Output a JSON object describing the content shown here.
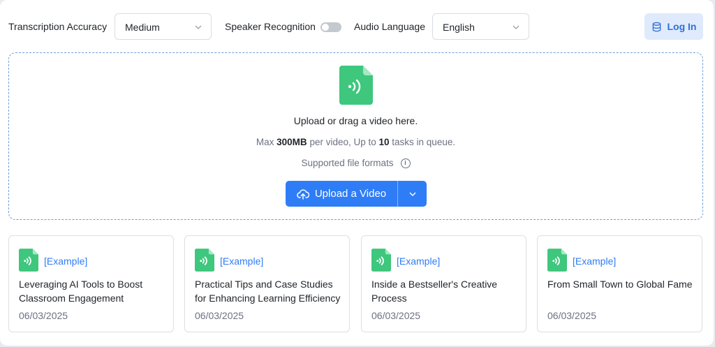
{
  "toolbar": {
    "accuracy_label": "Transcription Accuracy",
    "accuracy_value": "Medium",
    "speaker_label": "Speaker Recognition",
    "speaker_enabled": false,
    "language_label": "Audio Language",
    "language_value": "English",
    "login_label": "Log In"
  },
  "dropzone": {
    "title": "Upload or drag a video here.",
    "limit_prefix": "Max ",
    "limit_size": "300MB",
    "limit_mid": " per video, Up to ",
    "limit_count": "10",
    "limit_suffix": " tasks in queue.",
    "formats_label": "Supported file formats",
    "upload_button": "Upload a Video"
  },
  "cards": [
    {
      "tag": "[Example]",
      "title": "Leveraging AI Tools to Boost Classroom Engagement",
      "date": "06/03/2025"
    },
    {
      "tag": "[Example]",
      "title": "Practical Tips and Case Studies for Enhancing Learning Efficiency",
      "date": "06/03/2025"
    },
    {
      "tag": "[Example]",
      "title": "Inside a Bestseller's Creative Process",
      "date": "06/03/2025"
    },
    {
      "tag": "[Example]",
      "title": "From Small Town to Global Fame",
      "date": "06/03/2025"
    }
  ],
  "colors": {
    "accent": "#2f7df6",
    "file_icon_green": "#3ec77d",
    "login_bg": "#dfeafc"
  },
  "icons": {
    "select_chevron": "chevron-down-icon",
    "login": "database-icon",
    "file": "audio-file-icon",
    "info": "info-icon",
    "upload": "cloud-upload-icon"
  }
}
